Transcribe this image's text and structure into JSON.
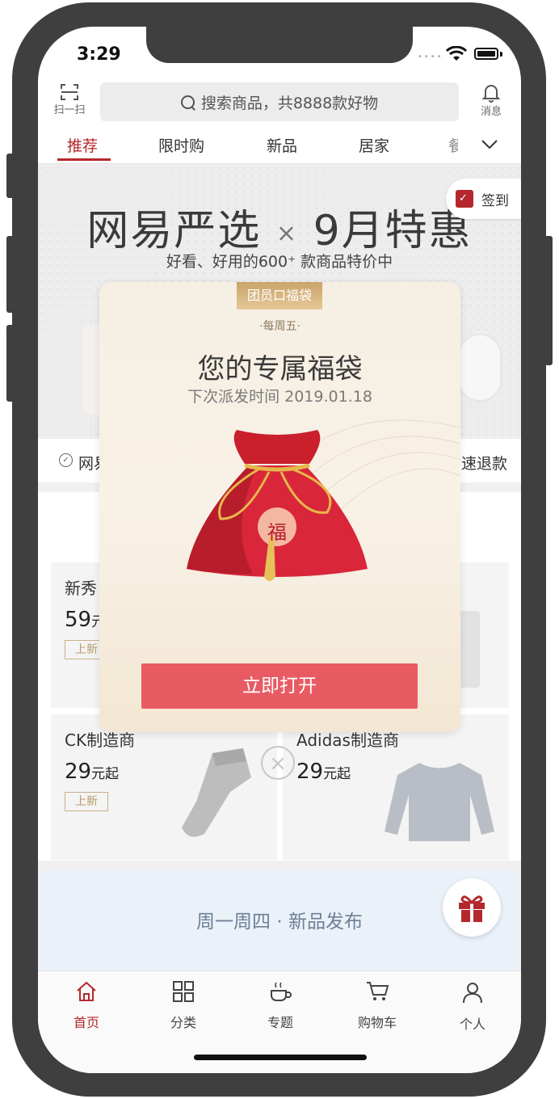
{
  "status": {
    "time": "3:29",
    "dots": "••••"
  },
  "header": {
    "scan_label": "扫一扫",
    "search_placeholder": "搜索商品，共8888款好物",
    "message_label": "消息"
  },
  "tabs": [
    {
      "label": "推荐",
      "active": true
    },
    {
      "label": "限时购"
    },
    {
      "label": "新品"
    },
    {
      "label": "居家"
    },
    {
      "label": "餐"
    }
  ],
  "banner": {
    "title_left": "网易严选",
    "title_x": "×",
    "title_right": "9月特惠",
    "subtitle": "好看、好用的600⁺ 款商品特价中",
    "signin_label": "签到"
  },
  "promise": {
    "left_text": "网易",
    "right_text": "速退款"
  },
  "cards": [
    {
      "brand": "新秀",
      "price": "59",
      "unit": "元",
      "tag": "上新"
    },
    {
      "brand": "CK制造商",
      "price": "29",
      "unit": "元起",
      "tag": "上新"
    },
    {
      "brand": "Adidas制造商",
      "price": "29",
      "unit": "元起"
    }
  ],
  "promo": {
    "text": "周一周四 · 新品发布"
  },
  "modal": {
    "ribbon": "团员口福袋",
    "weekly": "·每周五·",
    "title": "您的专属福袋",
    "subtitle": "下次派发时间 2019.01.18",
    "bag_char": "福",
    "open_button": "立即打开",
    "close": "×"
  },
  "bottom_nav": [
    {
      "label": "首页",
      "icon": "home-icon",
      "active": true
    },
    {
      "label": "分类",
      "icon": "grid-icon"
    },
    {
      "label": "专题",
      "icon": "cup-icon"
    },
    {
      "label": "购物车",
      "icon": "cart-icon"
    },
    {
      "label": "个人",
      "icon": "person-icon"
    }
  ],
  "colors": {
    "brand_red": "#b4282d",
    "button_red": "#e85b63",
    "gold": "#caa36b"
  }
}
